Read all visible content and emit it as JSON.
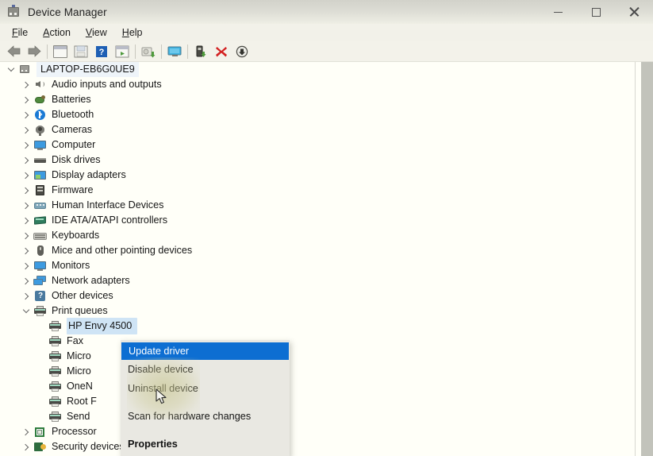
{
  "window": {
    "title": "Device Manager",
    "icon": "device-manager-icon",
    "controls": {
      "minimize": "─",
      "maximize": "□",
      "close": "✕"
    }
  },
  "menubar": {
    "items": [
      {
        "label": "File",
        "accesskey": "F"
      },
      {
        "label": "Action",
        "accesskey": "A"
      },
      {
        "label": "View",
        "accesskey": "V"
      },
      {
        "label": "Help",
        "accesskey": "H"
      }
    ]
  },
  "toolbar": {
    "buttons": [
      {
        "name": "back-button",
        "icon": "left-arrow-icon"
      },
      {
        "name": "forward-button",
        "icon": "right-arrow-icon"
      },
      {
        "name": "properties-button",
        "icon": "properties-icon"
      },
      {
        "name": "save-button",
        "icon": "save-icon"
      },
      {
        "name": "help-button",
        "icon": "question-mark-icon"
      },
      {
        "name": "show-hidden-button",
        "icon": "window-play-icon"
      },
      {
        "name": "update-driver-button",
        "icon": "update-driver-icon"
      },
      {
        "name": "scan-hardware-button",
        "icon": "monitor-scan-icon"
      },
      {
        "name": "enable-device-button",
        "icon": "device-plus-icon"
      },
      {
        "name": "disable-device-button",
        "icon": "red-x-icon"
      },
      {
        "name": "uninstall-device-button",
        "icon": "down-arrow-circle-icon"
      }
    ]
  },
  "tree": {
    "root": {
      "label": "LAPTOP-EB6G0UE9",
      "icon": "computer-icon",
      "expanded": true
    },
    "items": [
      {
        "label": "Audio inputs and outputs",
        "icon": "speaker-icon",
        "expanded": false,
        "indent": 1
      },
      {
        "label": "Batteries",
        "icon": "battery-icon",
        "expanded": false,
        "indent": 1
      },
      {
        "label": "Bluetooth",
        "icon": "bluetooth-icon",
        "expanded": false,
        "indent": 1
      },
      {
        "label": "Cameras",
        "icon": "camera-icon",
        "expanded": false,
        "indent": 1
      },
      {
        "label": "Computer",
        "icon": "monitor-icon",
        "expanded": false,
        "indent": 1
      },
      {
        "label": "Disk drives",
        "icon": "disk-icon",
        "expanded": false,
        "indent": 1
      },
      {
        "label": "Display adapters",
        "icon": "display-adapter-icon",
        "expanded": false,
        "indent": 1
      },
      {
        "label": "Firmware",
        "icon": "firmware-icon",
        "expanded": false,
        "indent": 1
      },
      {
        "label": "Human Interface Devices",
        "icon": "hid-icon",
        "expanded": false,
        "indent": 1
      },
      {
        "label": "IDE ATA/ATAPI controllers",
        "icon": "ide-controller-icon",
        "expanded": false,
        "indent": 1
      },
      {
        "label": "Keyboards",
        "icon": "keyboard-icon",
        "expanded": false,
        "indent": 1
      },
      {
        "label": "Mice and other pointing devices",
        "icon": "mouse-icon",
        "expanded": false,
        "indent": 1
      },
      {
        "label": "Monitors",
        "icon": "monitor-icon",
        "expanded": false,
        "indent": 1
      },
      {
        "label": "Network adapters",
        "icon": "network-adapter-icon",
        "expanded": false,
        "indent": 1
      },
      {
        "label": "Other devices",
        "icon": "other-device-icon",
        "expanded": false,
        "indent": 1
      },
      {
        "label": "Print queues",
        "icon": "printer-icon",
        "expanded": true,
        "indent": 1
      },
      {
        "label": "HP Envy 4500",
        "icon": "printer-icon",
        "expanded": null,
        "indent": 2,
        "selected": true
      },
      {
        "label": "Fax",
        "icon": "printer-icon",
        "expanded": null,
        "indent": 2
      },
      {
        "label": "Micro",
        "icon": "printer-icon",
        "expanded": null,
        "indent": 2,
        "truncated": true
      },
      {
        "label": "Micro",
        "icon": "printer-icon",
        "expanded": null,
        "indent": 2,
        "truncated": true
      },
      {
        "label": "OneN",
        "icon": "printer-icon",
        "expanded": null,
        "indent": 2,
        "truncated": true
      },
      {
        "label": "Root F",
        "icon": "printer-icon",
        "expanded": null,
        "indent": 2,
        "truncated": true
      },
      {
        "label": "Send ",
        "icon": "printer-icon",
        "expanded": null,
        "indent": 2,
        "truncated": true
      },
      {
        "label": "Processor",
        "icon": "processor-icon",
        "expanded": false,
        "indent": 1,
        "truncated": true
      },
      {
        "label": "Security devices",
        "icon": "security-device-icon",
        "expanded": false,
        "indent": 1
      }
    ]
  },
  "context_menu": {
    "items": [
      {
        "label": "Update driver",
        "accesskey": "p",
        "highlighted": true,
        "bold": false
      },
      {
        "label": "Disable device",
        "accesskey": "D",
        "highlighted": false,
        "bold": false
      },
      {
        "label": "Uninstall device",
        "accesskey": "U",
        "highlighted": false,
        "bold": false
      },
      {
        "label": "Scan for hardware changes",
        "accesskey": "S",
        "highlighted": false,
        "bold": false
      },
      {
        "label": "Properties",
        "accesskey": "",
        "highlighted": false,
        "bold": true
      }
    ]
  },
  "colors": {
    "titlebar_top": "#d2d2ca",
    "titlebar_bottom": "#eeeee4",
    "panel_bg": "#fffff8",
    "menu_bg": "#e9e8e2",
    "highlight_blue": "#0d6ed2",
    "selection_blue": "#cfe4f5",
    "toolbar_bg": "#f3f2ea",
    "red_x": "#d32020",
    "green_accent": "#4f8a3d"
  }
}
